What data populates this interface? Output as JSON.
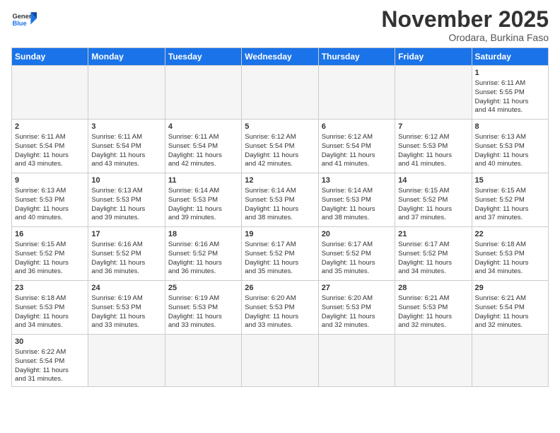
{
  "header": {
    "logo_general": "General",
    "logo_blue": "Blue",
    "month_title": "November 2025",
    "subtitle": "Orodara, Burkina Faso"
  },
  "days_of_week": [
    "Sunday",
    "Monday",
    "Tuesday",
    "Wednesday",
    "Thursday",
    "Friday",
    "Saturday"
  ],
  "weeks": [
    [
      {
        "day": "",
        "info": ""
      },
      {
        "day": "",
        "info": ""
      },
      {
        "day": "",
        "info": ""
      },
      {
        "day": "",
        "info": ""
      },
      {
        "day": "",
        "info": ""
      },
      {
        "day": "",
        "info": ""
      },
      {
        "day": "1",
        "info": "Sunrise: 6:11 AM\nSunset: 5:55 PM\nDaylight: 11 hours\nand 44 minutes."
      }
    ],
    [
      {
        "day": "2",
        "info": "Sunrise: 6:11 AM\nSunset: 5:54 PM\nDaylight: 11 hours\nand 43 minutes."
      },
      {
        "day": "3",
        "info": "Sunrise: 6:11 AM\nSunset: 5:54 PM\nDaylight: 11 hours\nand 43 minutes."
      },
      {
        "day": "4",
        "info": "Sunrise: 6:11 AM\nSunset: 5:54 PM\nDaylight: 11 hours\nand 42 minutes."
      },
      {
        "day": "5",
        "info": "Sunrise: 6:12 AM\nSunset: 5:54 PM\nDaylight: 11 hours\nand 42 minutes."
      },
      {
        "day": "6",
        "info": "Sunrise: 6:12 AM\nSunset: 5:54 PM\nDaylight: 11 hours\nand 41 minutes."
      },
      {
        "day": "7",
        "info": "Sunrise: 6:12 AM\nSunset: 5:53 PM\nDaylight: 11 hours\nand 41 minutes."
      },
      {
        "day": "8",
        "info": "Sunrise: 6:13 AM\nSunset: 5:53 PM\nDaylight: 11 hours\nand 40 minutes."
      }
    ],
    [
      {
        "day": "9",
        "info": "Sunrise: 6:13 AM\nSunset: 5:53 PM\nDaylight: 11 hours\nand 40 minutes."
      },
      {
        "day": "10",
        "info": "Sunrise: 6:13 AM\nSunset: 5:53 PM\nDaylight: 11 hours\nand 39 minutes."
      },
      {
        "day": "11",
        "info": "Sunrise: 6:14 AM\nSunset: 5:53 PM\nDaylight: 11 hours\nand 39 minutes."
      },
      {
        "day": "12",
        "info": "Sunrise: 6:14 AM\nSunset: 5:53 PM\nDaylight: 11 hours\nand 38 minutes."
      },
      {
        "day": "13",
        "info": "Sunrise: 6:14 AM\nSunset: 5:53 PM\nDaylight: 11 hours\nand 38 minutes."
      },
      {
        "day": "14",
        "info": "Sunrise: 6:15 AM\nSunset: 5:52 PM\nDaylight: 11 hours\nand 37 minutes."
      },
      {
        "day": "15",
        "info": "Sunrise: 6:15 AM\nSunset: 5:52 PM\nDaylight: 11 hours\nand 37 minutes."
      }
    ],
    [
      {
        "day": "16",
        "info": "Sunrise: 6:15 AM\nSunset: 5:52 PM\nDaylight: 11 hours\nand 36 minutes."
      },
      {
        "day": "17",
        "info": "Sunrise: 6:16 AM\nSunset: 5:52 PM\nDaylight: 11 hours\nand 36 minutes."
      },
      {
        "day": "18",
        "info": "Sunrise: 6:16 AM\nSunset: 5:52 PM\nDaylight: 11 hours\nand 36 minutes."
      },
      {
        "day": "19",
        "info": "Sunrise: 6:17 AM\nSunset: 5:52 PM\nDaylight: 11 hours\nand 35 minutes."
      },
      {
        "day": "20",
        "info": "Sunrise: 6:17 AM\nSunset: 5:52 PM\nDaylight: 11 hours\nand 35 minutes."
      },
      {
        "day": "21",
        "info": "Sunrise: 6:17 AM\nSunset: 5:52 PM\nDaylight: 11 hours\nand 34 minutes."
      },
      {
        "day": "22",
        "info": "Sunrise: 6:18 AM\nSunset: 5:53 PM\nDaylight: 11 hours\nand 34 minutes."
      }
    ],
    [
      {
        "day": "23",
        "info": "Sunrise: 6:18 AM\nSunset: 5:53 PM\nDaylight: 11 hours\nand 34 minutes."
      },
      {
        "day": "24",
        "info": "Sunrise: 6:19 AM\nSunset: 5:53 PM\nDaylight: 11 hours\nand 33 minutes."
      },
      {
        "day": "25",
        "info": "Sunrise: 6:19 AM\nSunset: 5:53 PM\nDaylight: 11 hours\nand 33 minutes."
      },
      {
        "day": "26",
        "info": "Sunrise: 6:20 AM\nSunset: 5:53 PM\nDaylight: 11 hours\nand 33 minutes."
      },
      {
        "day": "27",
        "info": "Sunrise: 6:20 AM\nSunset: 5:53 PM\nDaylight: 11 hours\nand 32 minutes."
      },
      {
        "day": "28",
        "info": "Sunrise: 6:21 AM\nSunset: 5:53 PM\nDaylight: 11 hours\nand 32 minutes."
      },
      {
        "day": "29",
        "info": "Sunrise: 6:21 AM\nSunset: 5:54 PM\nDaylight: 11 hours\nand 32 minutes."
      }
    ],
    [
      {
        "day": "30",
        "info": "Sunrise: 6:22 AM\nSunset: 5:54 PM\nDaylight: 11 hours\nand 31 minutes."
      },
      {
        "day": "",
        "info": ""
      },
      {
        "day": "",
        "info": ""
      },
      {
        "day": "",
        "info": ""
      },
      {
        "day": "",
        "info": ""
      },
      {
        "day": "",
        "info": ""
      },
      {
        "day": "",
        "info": ""
      }
    ]
  ]
}
